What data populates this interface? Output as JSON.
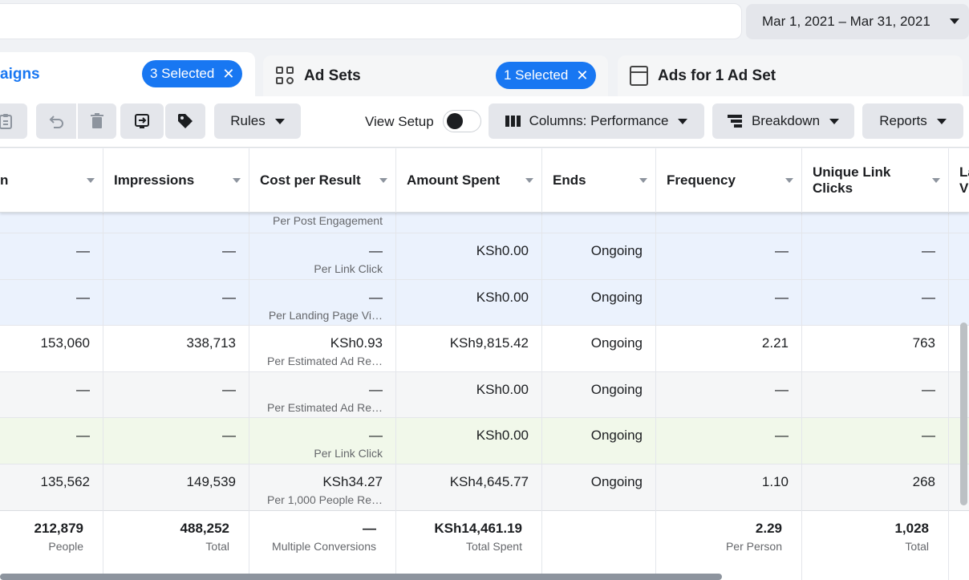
{
  "top": {
    "date_range": "Mar 1, 2021 – Mar 31, 2021"
  },
  "tabs": {
    "campaigns": {
      "label": "aigns",
      "pill": "3 Selected"
    },
    "adsets": {
      "label": "Ad Sets",
      "pill": "1 Selected"
    },
    "ads": {
      "label": "Ads for 1 Ad Set"
    }
  },
  "toolbar": {
    "rules": "Rules",
    "view_setup": "View Setup",
    "columns": "Columns: Performance",
    "breakdown": "Breakdown",
    "reports": "Reports"
  },
  "columns": {
    "c0": "n",
    "impressions": "Impressions",
    "cost": "Cost per Result",
    "spent": "Amount Spent",
    "ends": "Ends",
    "frequency": "Frequency",
    "ulc": "Unique Link Clicks",
    "last": "La Vi"
  },
  "rows": [
    {
      "c0": "",
      "impressions": "",
      "cost": "",
      "cost_sub": "Per Post Engagement",
      "spent": "",
      "ends": "",
      "frequency": "",
      "ulc": ""
    },
    {
      "c0": "—",
      "impressions": "—",
      "cost": "—",
      "cost_sub": "Per Link Click",
      "spent": "KSh0.00",
      "ends": "Ongoing",
      "frequency": "—",
      "ulc": "—"
    },
    {
      "c0": "—",
      "impressions": "—",
      "cost": "—",
      "cost_sub": "Per Landing Page Vi…",
      "spent": "KSh0.00",
      "ends": "Ongoing",
      "frequency": "—",
      "ulc": "—"
    },
    {
      "c0": "153,060",
      "impressions": "338,713",
      "cost": "KSh0.93",
      "cost_sub": "Per Estimated Ad Re…",
      "spent": "KSh9,815.42",
      "ends": "Ongoing",
      "frequency": "2.21",
      "ulc": "763"
    },
    {
      "c0": "—",
      "impressions": "—",
      "cost": "—",
      "cost_sub": "Per Estimated Ad Re…",
      "spent": "KSh0.00",
      "ends": "Ongoing",
      "frequency": "—",
      "ulc": "—"
    },
    {
      "c0": "—",
      "impressions": "—",
      "cost": "—",
      "cost_sub": "Per Link Click",
      "spent": "KSh0.00",
      "ends": "Ongoing",
      "frequency": "—",
      "ulc": "—"
    },
    {
      "c0": "135,562",
      "impressions": "149,539",
      "cost": "KSh34.27",
      "cost_sub": "Per 1,000 People Re…",
      "spent": "KSh4,645.77",
      "ends": "Ongoing",
      "frequency": "1.10",
      "ulc": "268"
    }
  ],
  "totals": {
    "c0": "212,879",
    "c0_sub": "People",
    "impressions": "488,252",
    "impressions_sub": "Total",
    "cost": "—",
    "cost_sub": "Multiple Conversions",
    "spent": "KSh14,461.19",
    "spent_sub": "Total Spent",
    "frequency": "2.29",
    "frequency_sub": "Per Person",
    "ulc": "1,028",
    "ulc_sub": "Total"
  },
  "colors": {
    "accent": "#1877f2",
    "selected_row": "#ebf2fd",
    "grey_row": "#f5f6f7",
    "green_row": "#f1f8ea"
  }
}
